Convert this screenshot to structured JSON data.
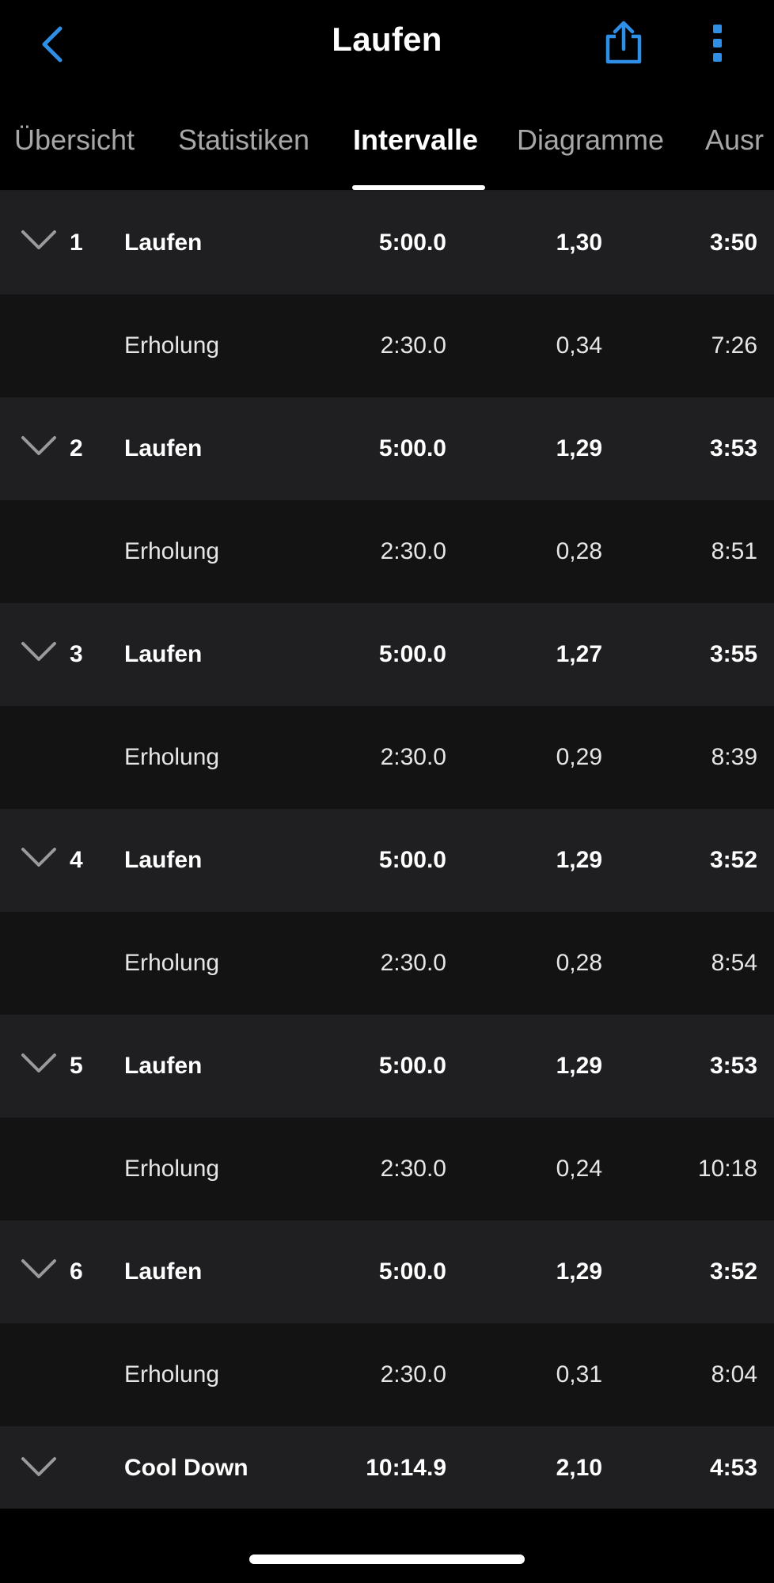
{
  "colors": {
    "accent": "#2f8fe6",
    "background": "#000000",
    "row_main": "#1f1f21",
    "row_sub": "#131314"
  },
  "header": {
    "title": "Laufen",
    "back_icon": "chevron-left-icon",
    "share_icon": "share-icon",
    "more_icon": "more-vertical-icon"
  },
  "tabs": [
    {
      "label": "Übersicht",
      "active": false
    },
    {
      "label": "Statistiken",
      "active": false
    },
    {
      "label": "Intervalle",
      "active": true
    },
    {
      "label": "Diagramme",
      "active": false
    },
    {
      "label": "Ausr",
      "active": false
    }
  ],
  "intervals": [
    {
      "index": "1",
      "label": "Laufen",
      "time": "5:00.0",
      "distance": "1,30",
      "pace": "3:50"
    },
    {
      "label": "Erholung",
      "time": "2:30.0",
      "distance": "0,34",
      "pace": "7:26"
    },
    {
      "index": "2",
      "label": "Laufen",
      "time": "5:00.0",
      "distance": "1,29",
      "pace": "3:53"
    },
    {
      "label": "Erholung",
      "time": "2:30.0",
      "distance": "0,28",
      "pace": "8:51"
    },
    {
      "index": "3",
      "label": "Laufen",
      "time": "5:00.0",
      "distance": "1,27",
      "pace": "3:55"
    },
    {
      "label": "Erholung",
      "time": "2:30.0",
      "distance": "0,29",
      "pace": "8:39"
    },
    {
      "index": "4",
      "label": "Laufen",
      "time": "5:00.0",
      "distance": "1,29",
      "pace": "3:52"
    },
    {
      "label": "Erholung",
      "time": "2:30.0",
      "distance": "0,28",
      "pace": "8:54"
    },
    {
      "index": "5",
      "label": "Laufen",
      "time": "5:00.0",
      "distance": "1,29",
      "pace": "3:53"
    },
    {
      "label": "Erholung",
      "time": "2:30.0",
      "distance": "0,24",
      "pace": "10:18"
    },
    {
      "index": "6",
      "label": "Laufen",
      "time": "5:00.0",
      "distance": "1,29",
      "pace": "3:52"
    },
    {
      "label": "Erholung",
      "time": "2:30.0",
      "distance": "0,31",
      "pace": "8:04"
    },
    {
      "label": "Cool Down",
      "time": "10:14.9",
      "distance": "2,10",
      "pace": "4:53"
    }
  ]
}
